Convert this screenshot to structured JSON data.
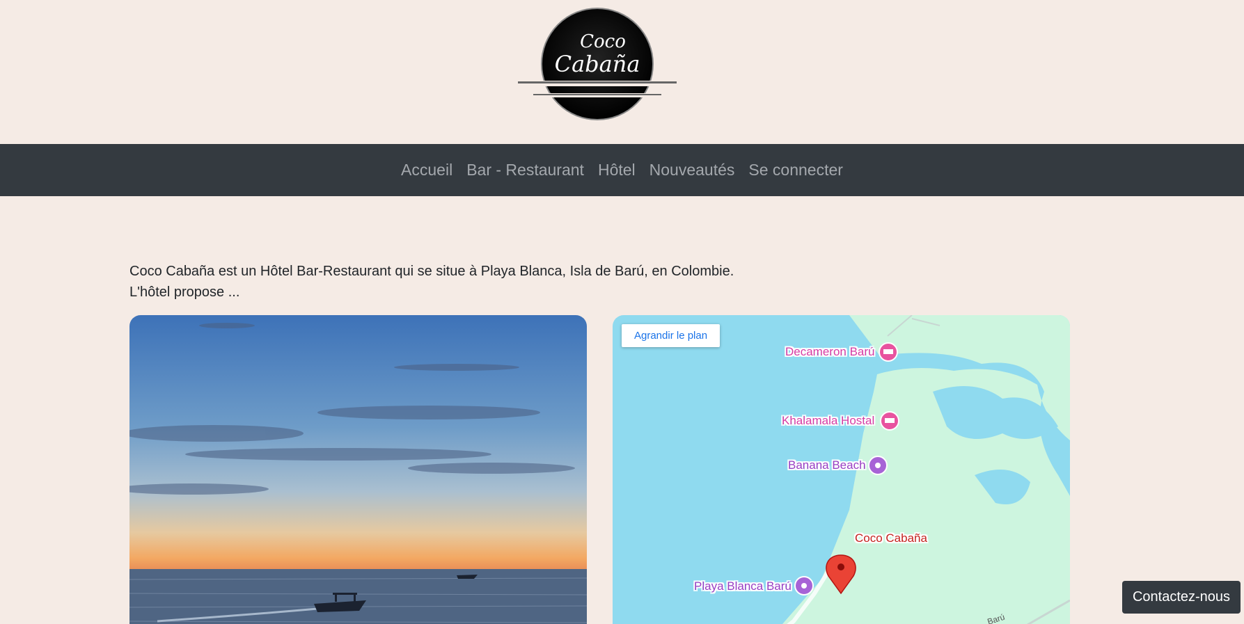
{
  "logo": {
    "line1": "Coco",
    "line2": "Cabaña"
  },
  "nav": {
    "items": [
      {
        "label": "Accueil"
      },
      {
        "label": "Bar - Restaurant"
      },
      {
        "label": "Hôtel"
      },
      {
        "label": "Nouveautés"
      },
      {
        "label": "Se connecter"
      }
    ]
  },
  "intro": {
    "line1": "Coco Cabaña est un Hôtel Bar-Restaurant qui se situe à Playa Blanca, Isla de Barú, en Colombie.",
    "line2": "L'hôtel propose ..."
  },
  "map": {
    "enlarge_label": "Agrandir le plan",
    "places": [
      {
        "name": "Decameron Barú",
        "icon": "hotel-icon"
      },
      {
        "name": "Khalamala Hostal",
        "icon": "hotel-icon"
      },
      {
        "name": "Banana Beach",
        "icon": "camera-icon"
      },
      {
        "name": "Coco Cabaña",
        "icon": "map-pin-icon"
      },
      {
        "name": "Playa Blanca Barú",
        "icon": "camera-icon"
      }
    ],
    "road_label": "Barú"
  },
  "contact": {
    "label": "Contactez-nous"
  },
  "colors": {
    "navbar": "#343a40",
    "background": "#f5ebe5",
    "water": "#8fdaef",
    "land": "#cdf5df"
  }
}
